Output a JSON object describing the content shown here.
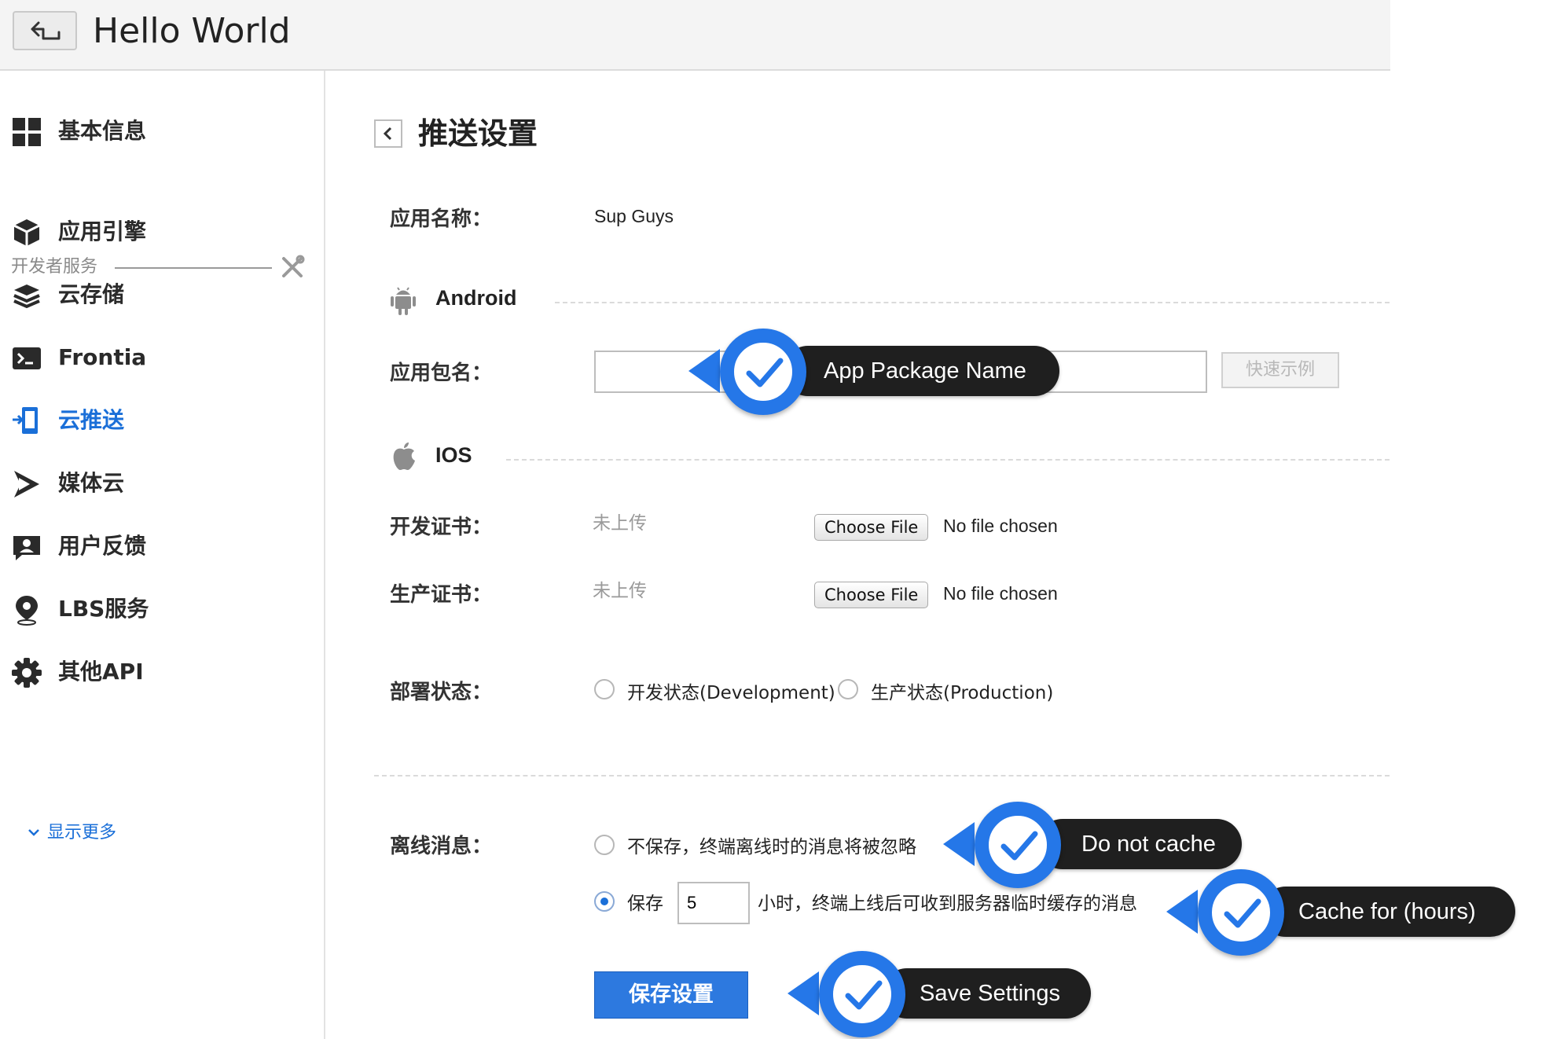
{
  "header": {
    "title": "Hello World",
    "back_icon": "return-arrow-icon"
  },
  "sidebar": {
    "basic_info": "基本信息",
    "dev_section": "开发者服务",
    "items": [
      {
        "label": "应用引擎",
        "icon": "cube-icon"
      },
      {
        "label": "云存储",
        "icon": "layers-icon"
      },
      {
        "label": "Frontia",
        "icon": "terminal-icon"
      },
      {
        "label": "云推送",
        "icon": "push-icon",
        "active": true
      },
      {
        "label": "媒体云",
        "icon": "play-icon"
      },
      {
        "label": "用户反馈",
        "icon": "user-feedback-icon"
      },
      {
        "label": "LBS服务",
        "icon": "location-pin-icon"
      },
      {
        "label": "其他API",
        "icon": "gear-icon"
      }
    ],
    "show_more": "显示更多"
  },
  "page": {
    "title": "推送设置",
    "app_name_label": "应用名称：",
    "app_name_value": "Sup Guys",
    "android_heading": "Android",
    "package_label": "应用包名：",
    "package_value": "",
    "quick_example": "快速示例",
    "ios_heading": "IOS",
    "dev_cert_label": "开发证书：",
    "dev_cert_status": "未上传",
    "prod_cert_label": "生产证书：",
    "prod_cert_status": "未上传",
    "choose_file": "Choose File",
    "no_file": "No file chosen",
    "deploy_label": "部署状态：",
    "deploy_dev": "开发状态(Development)",
    "deploy_prod": "生产状态(Production)",
    "offline_label": "离线消息：",
    "offline_no_cache": "不保存，终端离线时的消息将被忽略",
    "offline_cache": "保存",
    "offline_hours": "5",
    "offline_cache_suffix": "小时，终端上线后可收到服务器临时缓存的消息",
    "save_button": "保存设置"
  },
  "callouts": {
    "package": "App Package Name",
    "no_cache": "Do not cache",
    "cache_hours": "Cache for (hours)",
    "save": "Save Settings"
  },
  "colors": {
    "accent": "#1a6fd8",
    "callout_blue": "#2577e8",
    "callout_bar": "#1f1f1f"
  }
}
